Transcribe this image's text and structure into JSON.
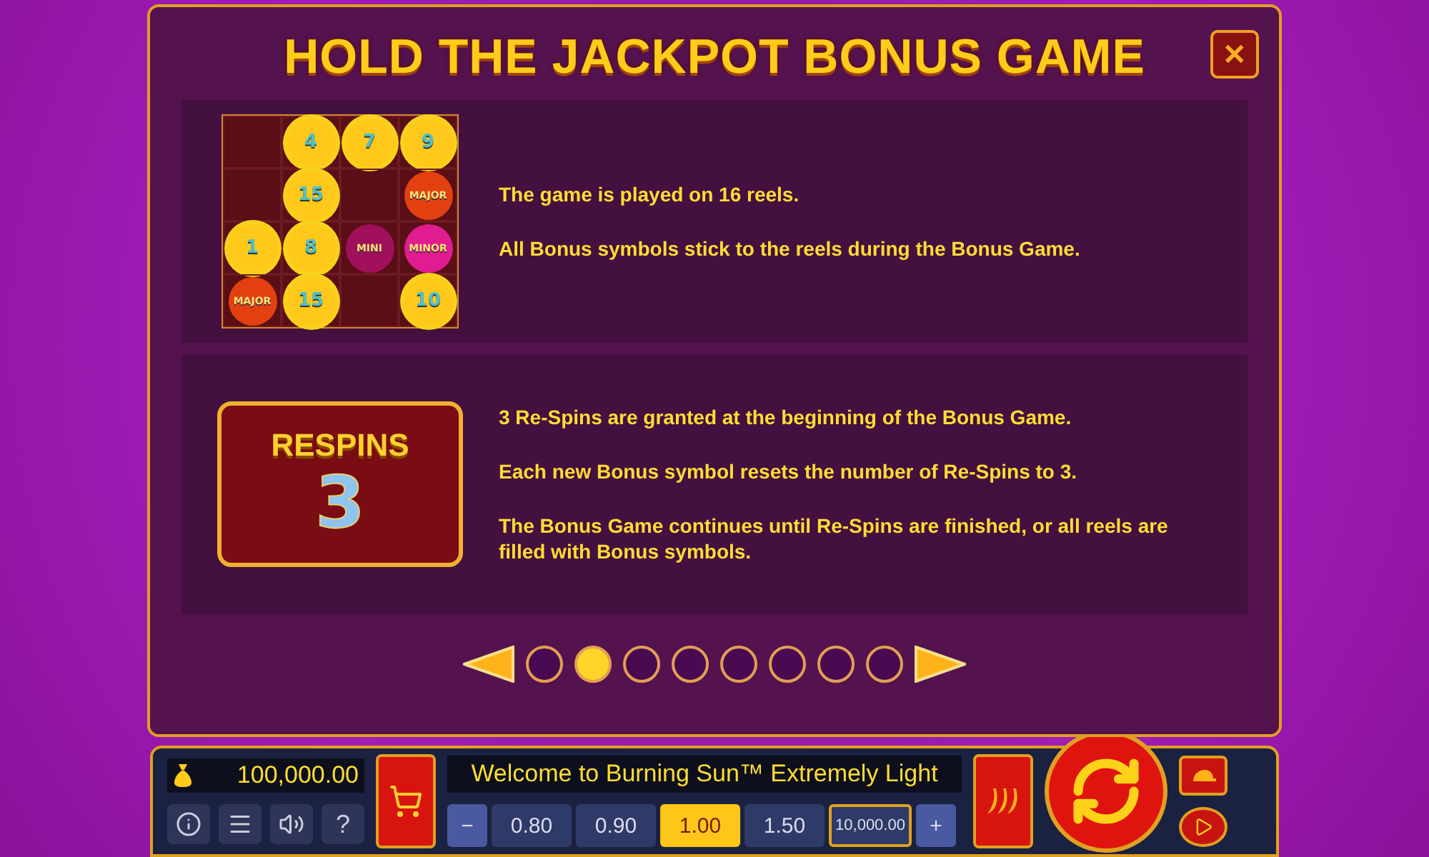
{
  "dialog": {
    "title": "HOLD THE JACKPOT BONUS GAME",
    "close": "✕"
  },
  "sections": [
    {
      "kind": "grid",
      "cells": [
        {
          "kind": "empty"
        },
        {
          "kind": "coin",
          "text": "4"
        },
        {
          "kind": "coin",
          "text": "7"
        },
        {
          "kind": "coin",
          "text": "9"
        },
        {
          "kind": "empty"
        },
        {
          "kind": "coin",
          "text": "15"
        },
        {
          "kind": "empty"
        },
        {
          "kind": "major",
          "text": "MAJOR"
        },
        {
          "kind": "coin",
          "text": "1"
        },
        {
          "kind": "coin",
          "text": "8"
        },
        {
          "kind": "mini",
          "text": "MINI"
        },
        {
          "kind": "minor",
          "text": "MINOR"
        },
        {
          "kind": "major",
          "text": "MAJOR"
        },
        {
          "kind": "coin",
          "text": "15"
        },
        {
          "kind": "empty"
        },
        {
          "kind": "coin",
          "text": "10"
        }
      ],
      "paragraphs": [
        "The game is played on 16 reels.",
        "All Bonus symbols stick to the reels during the Bonus Game."
      ]
    },
    {
      "kind": "respins",
      "label": "RESPINS",
      "count": "3",
      "paragraphs": [
        "3 Re-Spins are granted at the beginning of the Bonus Game.",
        "Each new Bonus symbol resets the number of Re-Spins to 3.",
        "The Bonus Game continues until Re-Spins are finished, or all reels are filled with Bonus symbols."
      ]
    }
  ],
  "pager": [
    {
      "selected": false
    },
    {
      "selected": true
    },
    {
      "selected": false
    },
    {
      "selected": false
    },
    {
      "selected": false
    },
    {
      "selected": false
    },
    {
      "selected": false
    },
    {
      "selected": false
    }
  ],
  "bottom_bar": {
    "balance": "100,000.00",
    "buttons": [
      {
        "kind": "info"
      },
      {
        "kind": "menu"
      },
      {
        "kind": "sound"
      },
      {
        "kind": "help",
        "text": "?"
      }
    ],
    "message": "Welcome to Burning Sun™ Extremely Light",
    "minus": "−",
    "plus": "+",
    "bets": [
      {
        "text": "0.80",
        "selected": false
      },
      {
        "text": "0.90",
        "selected": false
      },
      {
        "text": "1.00",
        "selected": true
      },
      {
        "text": "1.50",
        "selected": false
      }
    ],
    "total": "10,000.00"
  }
}
